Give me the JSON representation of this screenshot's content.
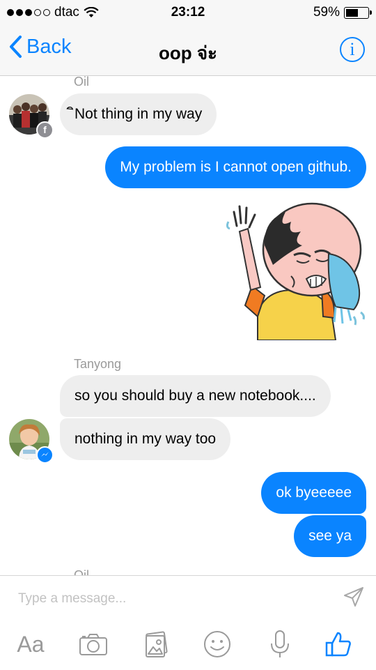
{
  "status_bar": {
    "carrier": "dtac",
    "time": "23:12",
    "battery_text": "59%",
    "battery_level": 0.59,
    "signal_bars": 3,
    "signal_total": 5
  },
  "nav": {
    "back_label": "Back",
    "title": "oop จ่ะ",
    "info_glyph": "i"
  },
  "messages": {
    "sender_oil": "Oil",
    "oil_msg": "ิNot thing in my way",
    "me_msg1": "My problem is I cannot open github.",
    "sticker": "crying-man-wiping-tears-sticker",
    "sender_tanyong": "Tanyong",
    "tanyong_msg1": "so you should buy a new notebook....",
    "tanyong_msg2": "nothing in my way too",
    "me_msg2": "ok byeeeee",
    "me_msg3": "see ya"
  },
  "composer": {
    "placeholder": "Type a message...",
    "tools": [
      "text-format-icon",
      "camera-icon",
      "gallery-icon",
      "emoji-icon",
      "microphone-icon",
      "like-icon"
    ],
    "aa_label": "Aa"
  },
  "colors": {
    "accent": "#0a84ff",
    "incoming_bubble": "#eeeeee",
    "facebook_badge": "#8e8e93",
    "messenger_badge": "#0a84ff"
  }
}
